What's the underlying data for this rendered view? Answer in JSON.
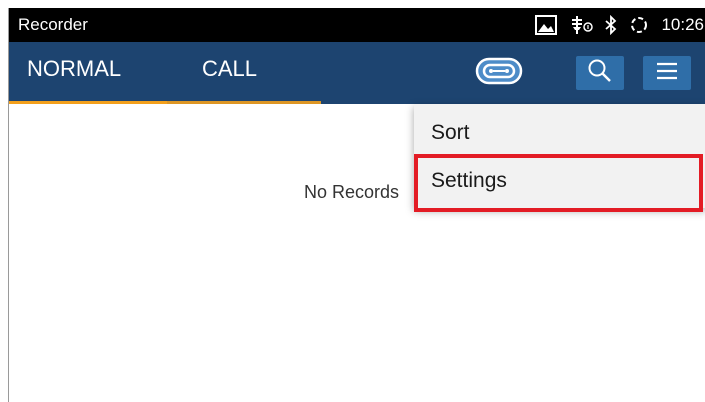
{
  "statusbar": {
    "title": "Recorder",
    "time": "10:26",
    "icons": [
      "picture-icon",
      "usb-icon",
      "bluetooth-icon",
      "sync-icon"
    ]
  },
  "tabs": [
    {
      "label": "NORMAL",
      "selected": true
    },
    {
      "label": "CALL",
      "selected": false
    }
  ],
  "toolbar": {
    "icons": [
      "voicemail-icon",
      "search-icon",
      "overflow-menu-icon"
    ]
  },
  "content": {
    "empty_text": "No Records"
  },
  "menu": {
    "items": [
      {
        "label": "Sort"
      },
      {
        "label": "Settings",
        "highlighted": true
      }
    ]
  },
  "colors": {
    "toolbar": "#1d4470",
    "accent": "#f3a01c",
    "highlight_border": "#e31c25",
    "button": "#2f6ea8"
  }
}
